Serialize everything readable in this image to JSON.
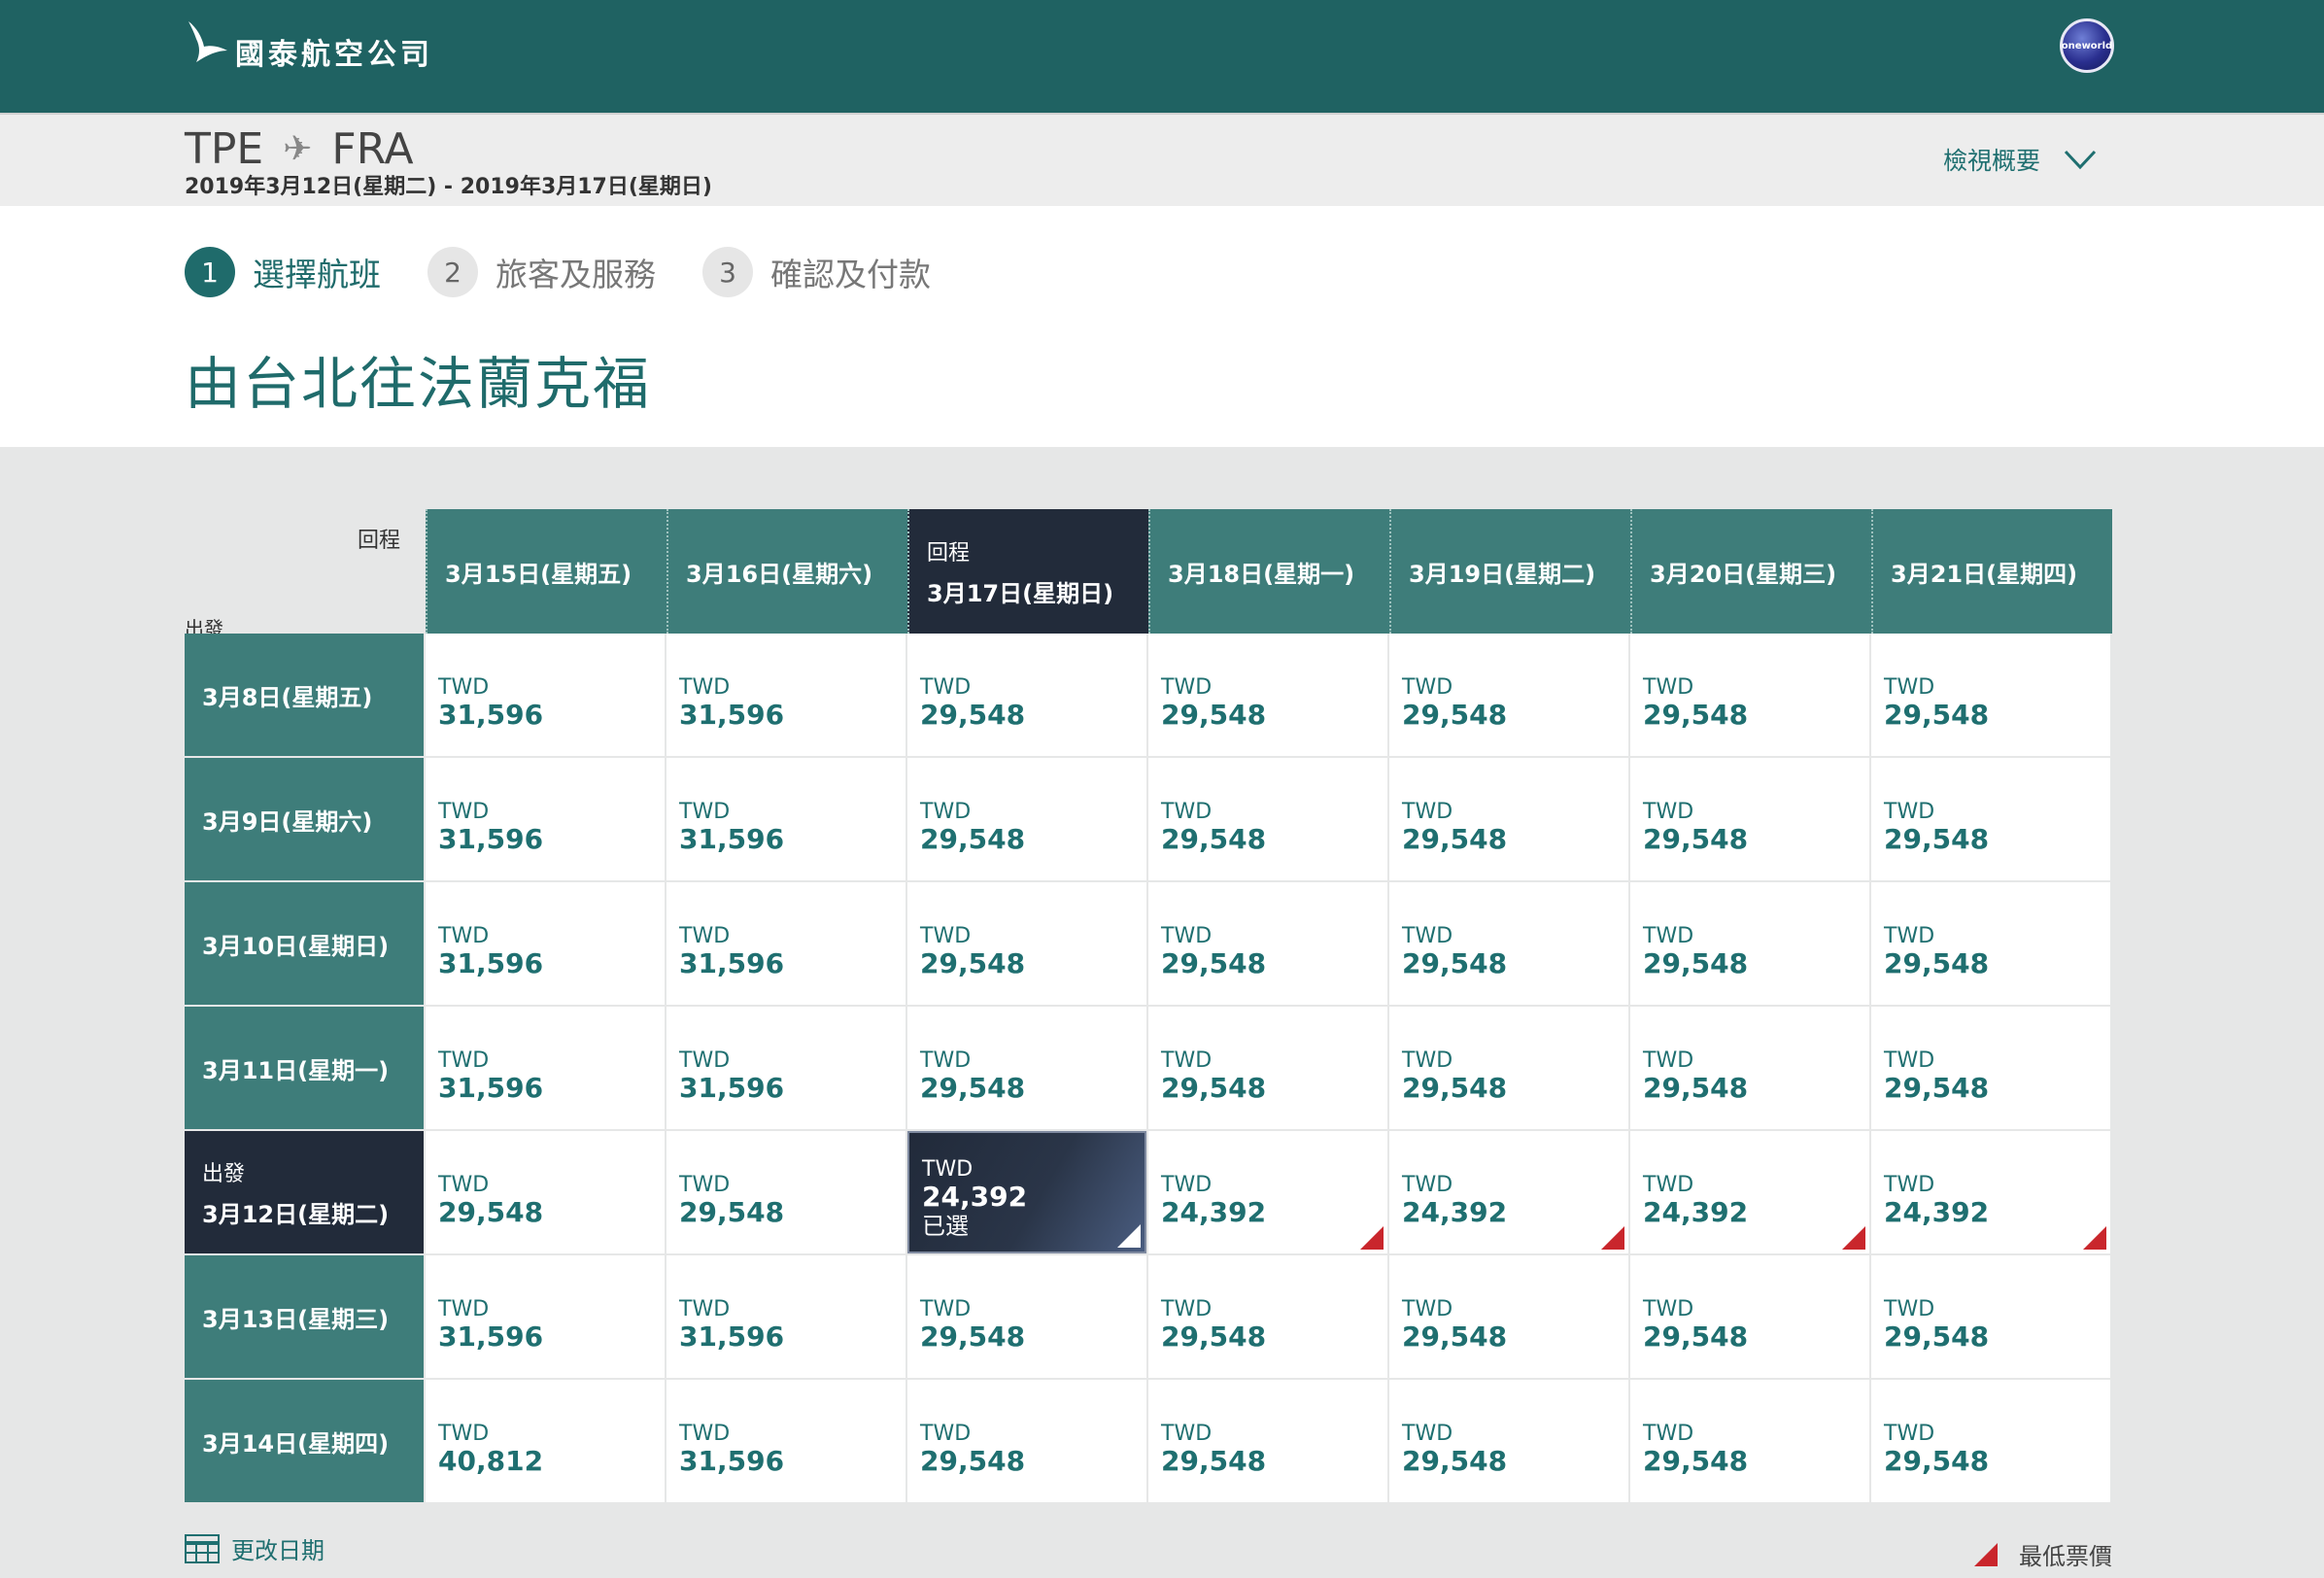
{
  "header": {
    "airline_name": "國泰航空公司",
    "alliance_badge": "oneworld"
  },
  "summary": {
    "origin": "TPE",
    "destination": "FRA",
    "dates": "2019年3月12日(星期二) - 2019年3月17日(星期日)",
    "overview_label": "檢視概要"
  },
  "steps": [
    {
      "num": "1",
      "label": "選擇航班"
    },
    {
      "num": "2",
      "label": "旅客及服務"
    },
    {
      "num": "3",
      "label": "確認及付款"
    }
  ],
  "page_title": "由台北往法蘭克福",
  "grid": {
    "return_label": "回程",
    "depart_label": "出發",
    "currency": "TWD",
    "selected_label": "已選",
    "columns": [
      "3月15日(星期五)",
      "3月16日(星期六)",
      "3月17日(星期日)",
      "3月18日(星期一)",
      "3月19日(星期二)",
      "3月20日(星期三)",
      "3月21日(星期四)"
    ],
    "rows": [
      {
        "date": "3月8日(星期五)",
        "prices": [
          "31,596",
          "31,596",
          "29,548",
          "29,548",
          "29,548",
          "29,548",
          "29,548"
        ]
      },
      {
        "date": "3月9日(星期六)",
        "prices": [
          "31,596",
          "31,596",
          "29,548",
          "29,548",
          "29,548",
          "29,548",
          "29,548"
        ]
      },
      {
        "date": "3月10日(星期日)",
        "prices": [
          "31,596",
          "31,596",
          "29,548",
          "29,548",
          "29,548",
          "29,548",
          "29,548"
        ]
      },
      {
        "date": "3月11日(星期一)",
        "prices": [
          "31,596",
          "31,596",
          "29,548",
          "29,548",
          "29,548",
          "29,548",
          "29,548"
        ]
      },
      {
        "date": "3月12日(星期二)",
        "prices": [
          "29,548",
          "29,548",
          "24,392",
          "24,392",
          "24,392",
          "24,392",
          "24,392"
        ]
      },
      {
        "date": "3月13日(星期三)",
        "prices": [
          "31,596",
          "31,596",
          "29,548",
          "29,548",
          "29,548",
          "29,548",
          "29,548"
        ]
      },
      {
        "date": "3月14日(星期四)",
        "prices": [
          "40,812",
          "31,596",
          "29,548",
          "29,548",
          "29,548",
          "29,548",
          "29,548"
        ]
      }
    ],
    "selected_row": 4,
    "selected_col": 2,
    "lowest_cells": [
      [
        4,
        3
      ],
      [
        4,
        4
      ],
      [
        4,
        5
      ],
      [
        4,
        6
      ]
    ]
  },
  "footer": {
    "change_dates_label": "更改日期",
    "legend_label": "最低票價"
  },
  "colors": {
    "brand": "#1f6262",
    "grid_header": "#3e7d7a",
    "selected": "#222b3a",
    "lowest_marker": "#c9262c"
  }
}
